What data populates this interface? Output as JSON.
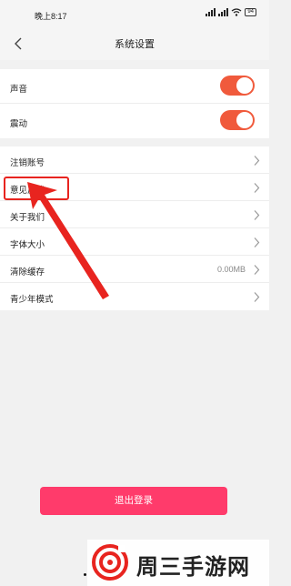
{
  "status_bar": {
    "time": "晚上8:17",
    "battery": "94",
    "icons": [
      "signal-icon",
      "signal-icon",
      "wifi-icon",
      "battery-icon"
    ]
  },
  "nav": {
    "back_icon": "chevron-left-icon",
    "title": "系统设置"
  },
  "toggles": [
    {
      "label": "声音",
      "on": true
    },
    {
      "label": "震动",
      "on": true
    }
  ],
  "menu": [
    {
      "label": "注销账号",
      "value": ""
    },
    {
      "label": "意见反馈",
      "value": ""
    },
    {
      "label": "关于我们",
      "value": ""
    },
    {
      "label": "字体大小",
      "value": ""
    },
    {
      "label": "清除缓存",
      "value": "0.00MB"
    },
    {
      "label": "青少年模式",
      "value": ""
    }
  ],
  "logout_button": "退出登录",
  "colors": {
    "toggle_on": "#f05a3c",
    "logout": "#ff3b6b",
    "annotation": "#e8241f"
  },
  "watermark": {
    "text": "周三手游网"
  }
}
